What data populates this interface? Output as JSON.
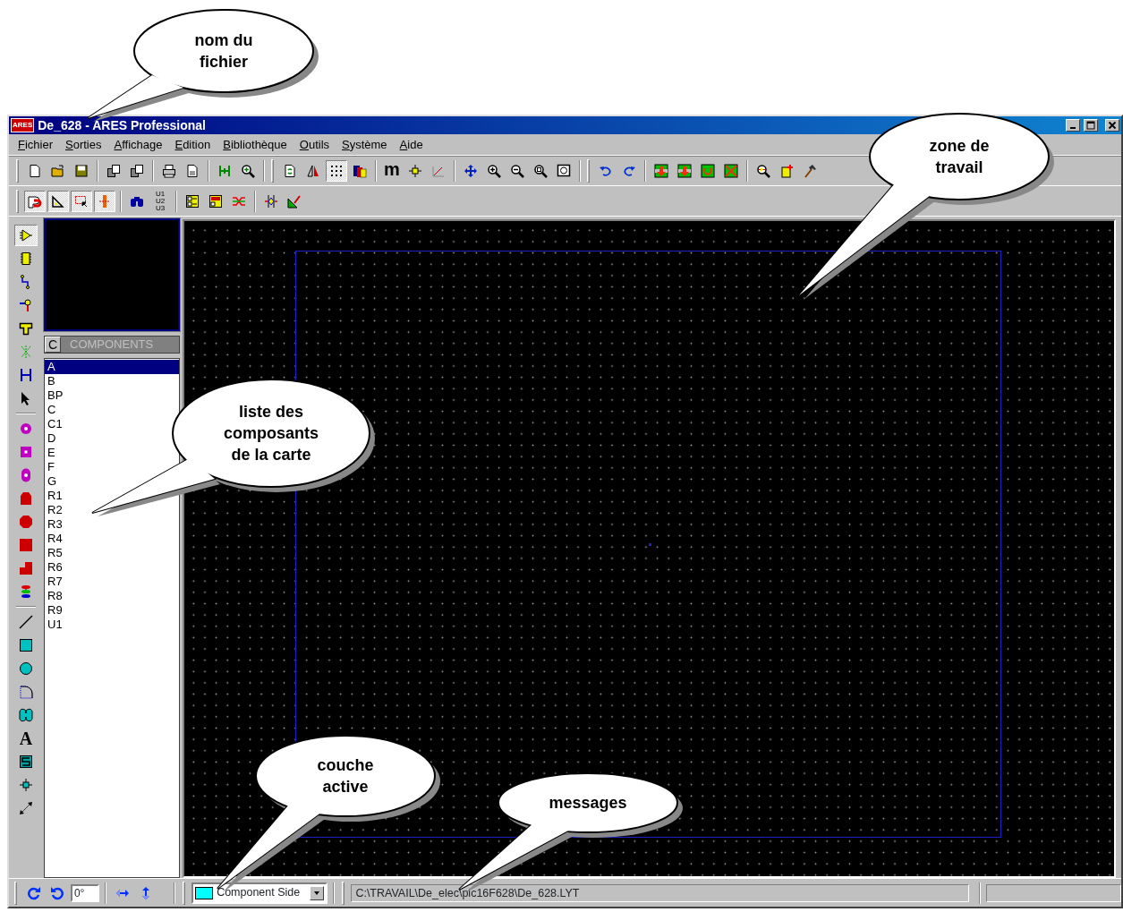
{
  "window": {
    "app_icon_label": "ARES",
    "title": "De_628 - ARES Professional"
  },
  "menu": [
    "Fichier",
    "Sorties",
    "Affichage",
    "Edition",
    "Bibliothèque",
    "Outils",
    "Système",
    "Aide"
  ],
  "toolbar_1": [
    {
      "selected": false
    },
    {
      "selected": false
    },
    {
      "selected": false
    },
    {
      "selected": false
    },
    {
      "selected": false
    },
    {
      "selected": false
    },
    {
      "selected": false
    },
    {
      "selected": false
    },
    {
      "selected": false
    },
    {
      "selected": false
    },
    {
      "selected": false
    },
    {
      "selected": true
    },
    {
      "selected": false
    },
    {
      "label": "m",
      "selected": false
    },
    {
      "selected": false
    },
    {
      "selected": false
    },
    {
      "selected": false
    },
    {
      "selected": false
    },
    {
      "selected": false
    },
    {
      "selected": false
    },
    {
      "selected": false
    },
    {
      "selected": false
    },
    {
      "selected": false
    },
    {
      "selected": false
    },
    {
      "selected": false
    },
    {
      "selected": false
    },
    {
      "selected": false
    },
    {
      "selected": false
    },
    {
      "selected": false
    },
    {
      "selected": false
    }
  ],
  "toolbar_2": [
    {
      "selected": true
    },
    {
      "selected": true
    },
    {
      "selected": true
    },
    {
      "selected": true
    },
    {
      "selected": false
    },
    {
      "label": "U1 U2 U3",
      "selected": false
    },
    {
      "selected": false
    },
    {
      "selected": false
    },
    {
      "selected": false
    },
    {
      "selected": false
    },
    {
      "selected": false
    }
  ],
  "tools": [
    {
      "selected": true
    },
    {
      "selected": false
    },
    {
      "selected": false
    },
    {
      "selected": false
    },
    {
      "selected": false
    },
    {
      "selected": false
    },
    {
      "selected": false
    },
    {
      "selected": false
    },
    {
      "selected": false
    },
    {
      "selected": false
    },
    {
      "selected": false
    },
    {
      "selected": false
    },
    {
      "selected": false
    },
    {
      "selected": false
    },
    {
      "selected": false
    },
    {
      "selected": false
    },
    {
      "selected": false
    },
    {
      "selected": false
    },
    {
      "selected": false
    },
    {
      "selected": false
    },
    {
      "selected": false
    },
    {
      "label": "A",
      "selected": false
    },
    {
      "selected": false
    },
    {
      "selected": false
    },
    {
      "selected": false
    }
  ],
  "component_list": {
    "mode_button": "C",
    "title": "COMPONENTS",
    "items": [
      {
        "label": "A",
        "selected": true
      },
      {
        "label": "B",
        "selected": false
      },
      {
        "label": "BP",
        "selected": false
      },
      {
        "label": "C",
        "selected": false
      },
      {
        "label": "C1",
        "selected": false
      },
      {
        "label": "D",
        "selected": false
      },
      {
        "label": "E",
        "selected": false
      },
      {
        "label": "F",
        "selected": false
      },
      {
        "label": "G",
        "selected": false
      },
      {
        "label": "R1",
        "selected": false
      },
      {
        "label": "R2",
        "selected": false
      },
      {
        "label": "R3",
        "selected": false
      },
      {
        "label": "R4",
        "selected": false
      },
      {
        "label": "R5",
        "selected": false
      },
      {
        "label": "R6",
        "selected": false
      },
      {
        "label": "R7",
        "selected": false
      },
      {
        "label": "R8",
        "selected": false
      },
      {
        "label": "R9",
        "selected": false
      },
      {
        "label": "U1",
        "selected": false
      }
    ]
  },
  "status_bar": {
    "angle": "0°",
    "layer": "Component Side",
    "message": "C:\\TRAVAIL\\De_elec\\pic16F628\\De_628.LYT"
  },
  "callouts": [
    {
      "text": "nom du fichier"
    },
    {
      "text": "zone de travail"
    },
    {
      "text": "liste des composants de la carte"
    },
    {
      "text": "couche active"
    },
    {
      "text": "messages"
    }
  ]
}
